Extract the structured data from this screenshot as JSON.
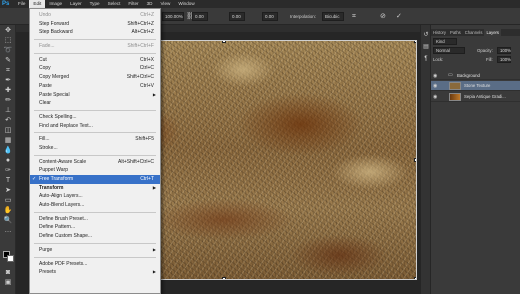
{
  "app": {
    "logo": "Ps"
  },
  "menubar": {
    "items": [
      "File",
      "Edit",
      "Image",
      "Layer",
      "Type",
      "Select",
      "Filter",
      "3D",
      "View",
      "Window"
    ]
  },
  "options": {
    "angle_value": "0.00",
    "h_skew": "0.00",
    "v_skew": "0.00",
    "zoom_value": "100.00%",
    "h_value": "100.00%",
    "interpolation_label": "Interpolation:",
    "interpolation_value": "Bicubic"
  },
  "doc_tab": {
    "close_glyph": "×"
  },
  "edit_menu": {
    "items": [
      {
        "label": "Undo",
        "shortcut": "Ctrl+Z"
      },
      {
        "label": "Step Forward",
        "shortcut": "Shift+Ctrl+Z"
      },
      {
        "label": "Step Backward",
        "shortcut": "Alt+Ctrl+Z"
      },
      {
        "label": "Fade...",
        "shortcut": "Shift+Ctrl+F"
      },
      {
        "label": "Cut",
        "shortcut": "Ctrl+X"
      },
      {
        "label": "Copy",
        "shortcut": "Ctrl+C"
      },
      {
        "label": "Copy Merged",
        "shortcut": "Shift+Ctrl+C"
      },
      {
        "label": "Paste",
        "shortcut": "Ctrl+V"
      },
      {
        "label": "Paste Special",
        "arrow": "▶"
      },
      {
        "label": "Clear"
      },
      {
        "label": "Check Spelling..."
      },
      {
        "label": "Find and Replace Text..."
      },
      {
        "label": "Fill...",
        "shortcut": "Shift+F5"
      },
      {
        "label": "Stroke..."
      },
      {
        "label": "Content-Aware Scale",
        "shortcut": "Alt+Shift+Ctrl+C"
      },
      {
        "label": "Puppet Warp"
      },
      {
        "label": "Free Transform",
        "shortcut": "Ctrl+T",
        "check": "✓"
      },
      {
        "label": "Transform",
        "arrow": "▶"
      },
      {
        "label": "Auto-Align Layers..."
      },
      {
        "label": "Auto-Blend Layers..."
      },
      {
        "label": "Define Brush Preset..."
      },
      {
        "label": "Define Pattern..."
      },
      {
        "label": "Define Custom Shape..."
      },
      {
        "label": "Purge",
        "arrow": "▶"
      },
      {
        "label": "Adobe PDF Presets..."
      },
      {
        "label": "Presets",
        "arrow": "▶"
      }
    ]
  },
  "panel": {
    "tabs": [
      "History",
      "Paths",
      "Channels",
      "Layers"
    ],
    "kind_value": "Kind",
    "blend_mode": "Normal",
    "opacity_label": "Opacity:",
    "opacity_value": "100%",
    "lock_label": "Lock:",
    "fill_label": "Fill:",
    "fill_value": "100%",
    "group_name": "Background",
    "layers": [
      {
        "name": "Stone Texture"
      },
      {
        "name": "Sepia Antique Gradi..."
      }
    ]
  },
  "colors": {
    "highlight": "#3771c8",
    "selected_layer": "#5a6d86",
    "ps_blue": "#2fa3ee"
  }
}
